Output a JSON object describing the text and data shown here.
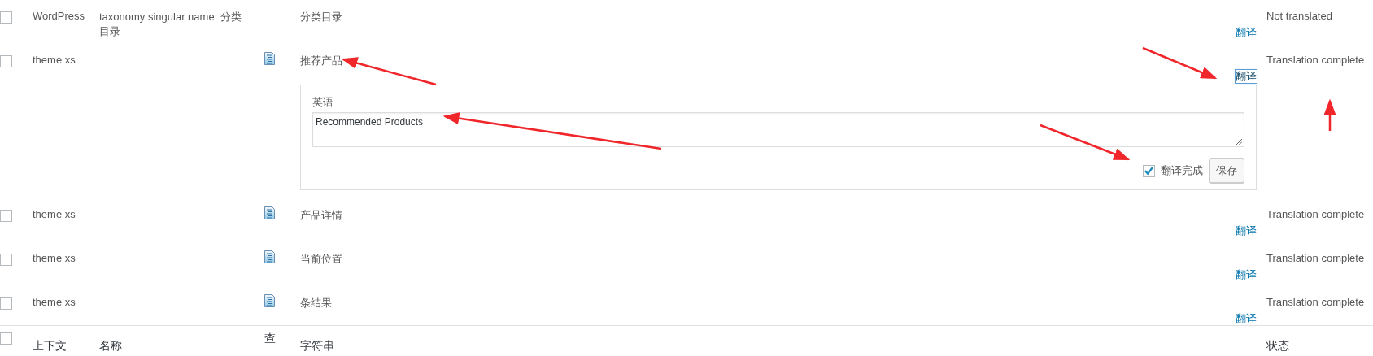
{
  "rows": [
    {
      "checked": false,
      "context": "WordPress",
      "name": "taxonomy singular name: 分类目录",
      "has_icon": false,
      "string": "分类目录",
      "action": "翻译",
      "focused": false,
      "status": "Not translated"
    },
    {
      "checked": false,
      "context": "theme xs",
      "name": "",
      "has_icon": true,
      "string": "推荐产品",
      "action": "翻译",
      "focused": true,
      "status": "Translation complete",
      "editor": {
        "label": "英语",
        "value": "Recommended Products",
        "complete_label": "翻译完成",
        "complete": true,
        "save": "保存"
      }
    },
    {
      "checked": false,
      "context": "theme xs",
      "name": "",
      "has_icon": true,
      "string": "产品详情",
      "action": "翻译",
      "focused": false,
      "status": "Translation complete"
    },
    {
      "checked": false,
      "context": "theme xs",
      "name": "",
      "has_icon": true,
      "string": "当前位置",
      "action": "翻译",
      "focused": false,
      "status": "Translation complete"
    },
    {
      "checked": false,
      "context": "theme xs",
      "name": "",
      "has_icon": true,
      "string": "条结果",
      "action": "翻译",
      "focused": false,
      "status": "Translation complete"
    }
  ],
  "footer": {
    "checked": false,
    "columns": [
      "上下文",
      "名称",
      "查",
      "字符串",
      "状态"
    ]
  }
}
